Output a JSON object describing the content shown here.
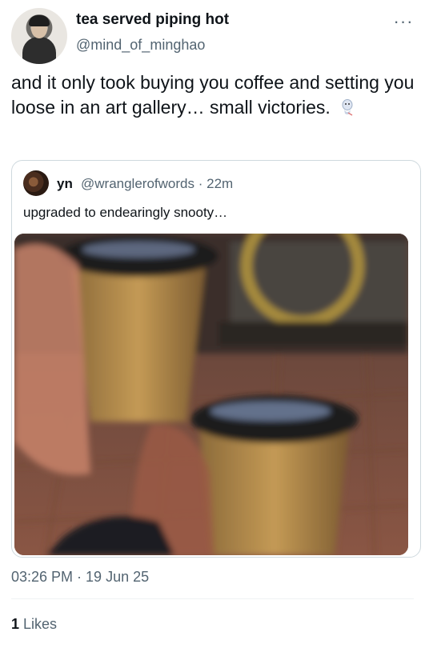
{
  "tweet": {
    "author": {
      "display_name": "tea served piping hot",
      "handle": "@mind_of_minghao"
    },
    "text": "and it only took buying you coffee and setting you loose in an art gallery… small victories.",
    "emoji": "seal-emoji",
    "timestamp": "03:26 PM · 19 Jun 25",
    "likes": {
      "count": "1",
      "label": "Likes"
    }
  },
  "quoted_tweet": {
    "author": {
      "display_name": "yn",
      "handle": "@wranglerofwords",
      "time": "22m"
    },
    "separator": "·",
    "text": "upgraded to endearingly snooty…",
    "media": {
      "description_icon": "coffee-cups-photo"
    }
  },
  "icons": {
    "more": "more-horizontal-icon"
  },
  "colors": {
    "secondary_text": "#536471",
    "primary_text": "#0f1419",
    "border": "#cfd9de"
  }
}
